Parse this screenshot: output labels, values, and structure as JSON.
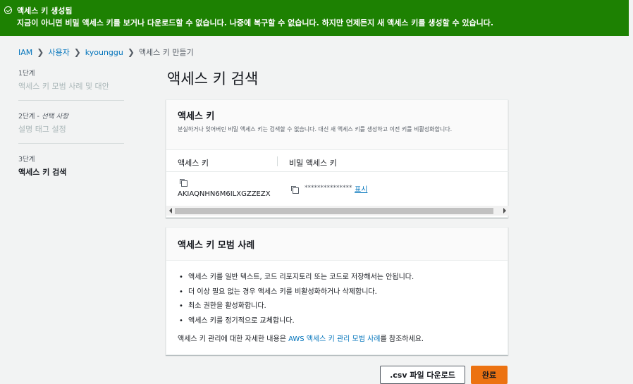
{
  "banner": {
    "title": "액세스 키 생성됨",
    "message": "지금이 아니면 비밀 액세스 키를 보거나 다운로드할 수 없습니다. 나중에 복구할 수 없습니다. 하지만 언제든지 새 액세스 키를 생성할 수 있습니다.",
    "icon": "check-circle-icon",
    "color": "#1d8102"
  },
  "breadcrumb": {
    "items": [
      "IAM",
      "사용자",
      "kyounggu"
    ],
    "current": "액세스 키 만들기"
  },
  "steps": [
    {
      "label": "1단계",
      "optional": "",
      "name": "액세스 키 모범 사례 및 대안"
    },
    {
      "label": "2단계 - ",
      "optional": "선택 사항",
      "name": "설명 태그 설정"
    },
    {
      "label": "3단계",
      "optional": "",
      "name": "액세스 키 검색"
    }
  ],
  "page_title": "액세스 키 검색",
  "access_key_panel": {
    "title": "액세스 키",
    "description": "분실하거나 잊어버린 비밀 액세스 키는 검색할 수 없습니다. 대신 새 액세스 키를 생성하고 이전 키를 비활성화합니다.",
    "columns": [
      "액세스 키",
      "비밀 액세스 키"
    ],
    "access_key_id": "AKIAQNHN6M6ILXGZZEZX",
    "secret_masked": "***************",
    "show_label": "표시"
  },
  "best_practices": {
    "title": "액세스 키 모범 사례",
    "items": [
      "액세스 키를 일반 텍스트, 코드 리포지토리 또는 코드로 저장해서는 안됩니다.",
      "더 이상 필요 없는 경우 액세스 키를 비활성화하거나 삭제합니다.",
      "최소 권한을 활성화합니다.",
      "액세스 키를 정기적으로 교체합니다."
    ],
    "more_prefix": "액세스 키 관리에 대한 자세한 내용은 ",
    "more_link": "AWS 액세스 키 관리 모범 사례",
    "more_suffix": "를 참조하세요."
  },
  "buttons": {
    "download_csv": ".csv 파일 다운로드",
    "done": "완료"
  }
}
